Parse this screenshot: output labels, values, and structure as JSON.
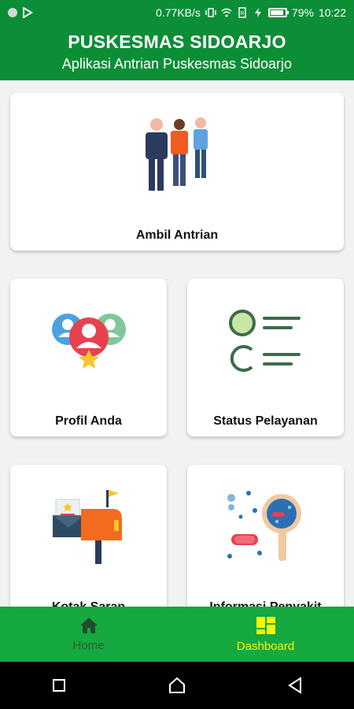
{
  "status_bar": {
    "speed": "0.77KB/s",
    "battery": "79%",
    "battery_level": 0.79,
    "time": "10:22"
  },
  "header": {
    "title": "PUSKESMAS SIDOARJO",
    "subtitle": "Aplikasi Antrian Puskesmas Sidoarjo"
  },
  "cards": {
    "ambil_antrian": "Ambil Antrian",
    "profil_anda": "Profil Anda",
    "status_pelayanan": "Status Pelayanan",
    "kotak_saran": "Kotak Saran",
    "informasi_penyakit": "Informasi Penyakit"
  },
  "bottom_nav": {
    "home": "Home",
    "dashboard": "Dashboard",
    "active": "dashboard"
  },
  "colors": {
    "primary": "#0b8e36",
    "nav": "#15a93f",
    "active": "#fff200"
  }
}
